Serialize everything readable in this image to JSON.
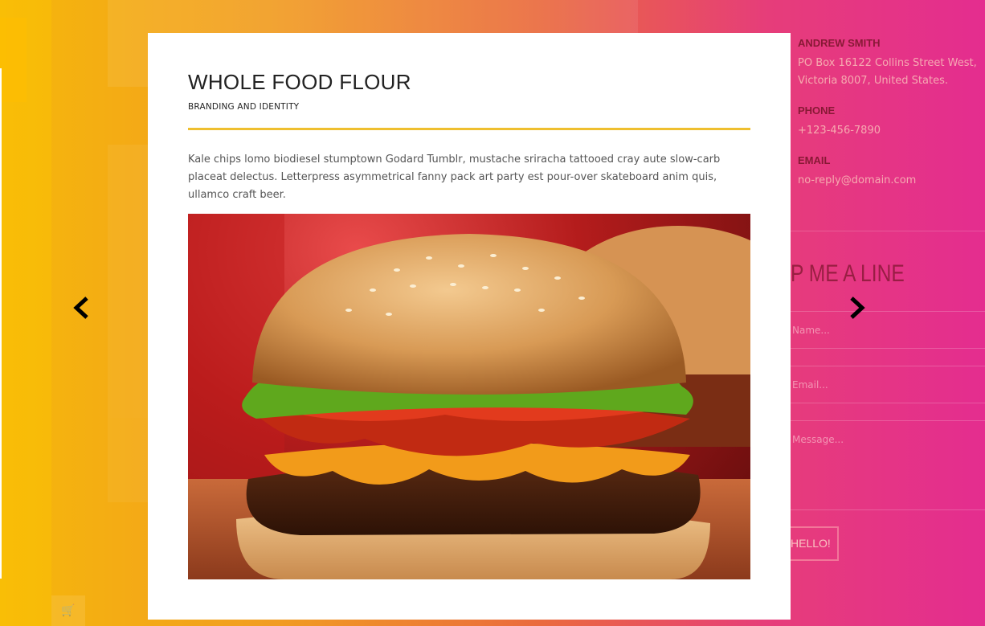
{
  "modal": {
    "title": "WHOLE FOOD FLOUR",
    "subtitle": "BRANDING AND IDENTITY",
    "description": "Kale chips lomo biodiesel stumptown Godard Tumblr, mustache sriracha tattooed cray aute slow-carb placeat delectus. Letterpress asymmetrical fanny pack art party est pour-over skateboard anim quis, ullamco craft beer.",
    "image_subject": "cheeseburger",
    "accent_color": "#efbf2f"
  },
  "nav": {
    "prev_icon": "chevron-left-icon",
    "next_icon": "chevron-right-icon"
  },
  "contact": {
    "name": "ANDREW SMITH",
    "address": "PO Box 16122 Collins Street West, Victoria 8007, United States.",
    "phone_label": "PHONE",
    "phone": "+123-456-7890",
    "email_label": "EMAIL",
    "email": "no-reply@domain.com"
  },
  "form": {
    "heading": "P ME A LINE",
    "name_placeholder": "Name...",
    "email_placeholder": "Email...",
    "message_placeholder": "Message...",
    "submit_label": "HELLO!"
  },
  "background": {
    "gradient_start": "#f6b80a",
    "gradient_end": "#e42d8f"
  }
}
